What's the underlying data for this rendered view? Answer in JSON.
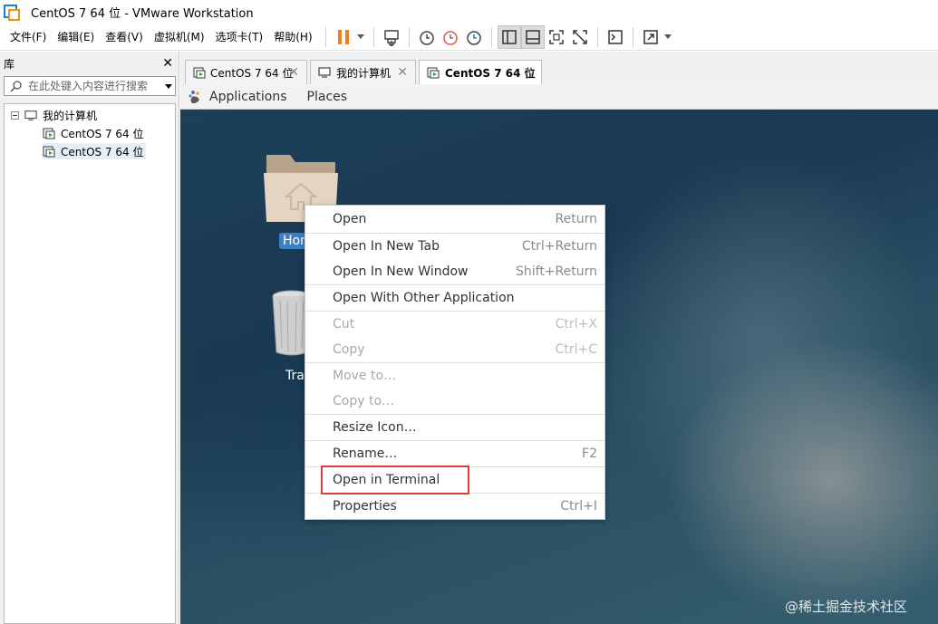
{
  "window": {
    "title": "CentOS 7 64 位 - VMware Workstation"
  },
  "menubar": {
    "items": [
      "文件(F)",
      "编辑(E)",
      "查看(V)",
      "虚拟机(M)",
      "选项卡(T)",
      "帮助(H)"
    ]
  },
  "library": {
    "title": "库",
    "search_placeholder": "在此处键入内容进行搜索",
    "tree": {
      "root": "我的计算机",
      "children": [
        "CentOS 7 64 位",
        "CentOS 7 64 位"
      ]
    }
  },
  "tabs": [
    {
      "label": "CentOS 7 64 位",
      "active": false
    },
    {
      "label": "我的计算机",
      "active": false
    },
    {
      "label": "CentOS 7 64 位",
      "active": true
    }
  ],
  "gnome": {
    "applications": "Applications",
    "places": "Places"
  },
  "desktop": {
    "home_label_partial": "Hom",
    "trash_label_partial": "Tra"
  },
  "context_menu": {
    "items": [
      {
        "label": "Open",
        "accel": "Return",
        "enabled": true
      },
      {
        "label": "Open In New Tab",
        "accel": "Ctrl+Return",
        "enabled": true
      },
      {
        "label": "Open In New Window",
        "accel": "Shift+Return",
        "enabled": true
      },
      {
        "label": "Open With Other Application",
        "accel": "",
        "enabled": true
      },
      {
        "label": "Cut",
        "accel": "Ctrl+X",
        "enabled": false
      },
      {
        "label": "Copy",
        "accel": "Ctrl+C",
        "enabled": false
      },
      {
        "label": "Move to…",
        "accel": "",
        "enabled": false
      },
      {
        "label": "Copy to…",
        "accel": "",
        "enabled": false
      },
      {
        "label": "Resize Icon…",
        "accel": "",
        "enabled": true
      },
      {
        "label": "Rename…",
        "accel": "F2",
        "enabled": true
      },
      {
        "label": "Open in Terminal",
        "accel": "",
        "enabled": true
      },
      {
        "label": "Properties",
        "accel": "Ctrl+I",
        "enabled": true
      }
    ],
    "highlighted_item": "Open in Terminal",
    "highlight_color": "#d9403a"
  },
  "watermark": "@稀土掘金技术社区",
  "colors": {
    "pause_icon": "#f07d1e",
    "selection": "#3d7fc5"
  }
}
